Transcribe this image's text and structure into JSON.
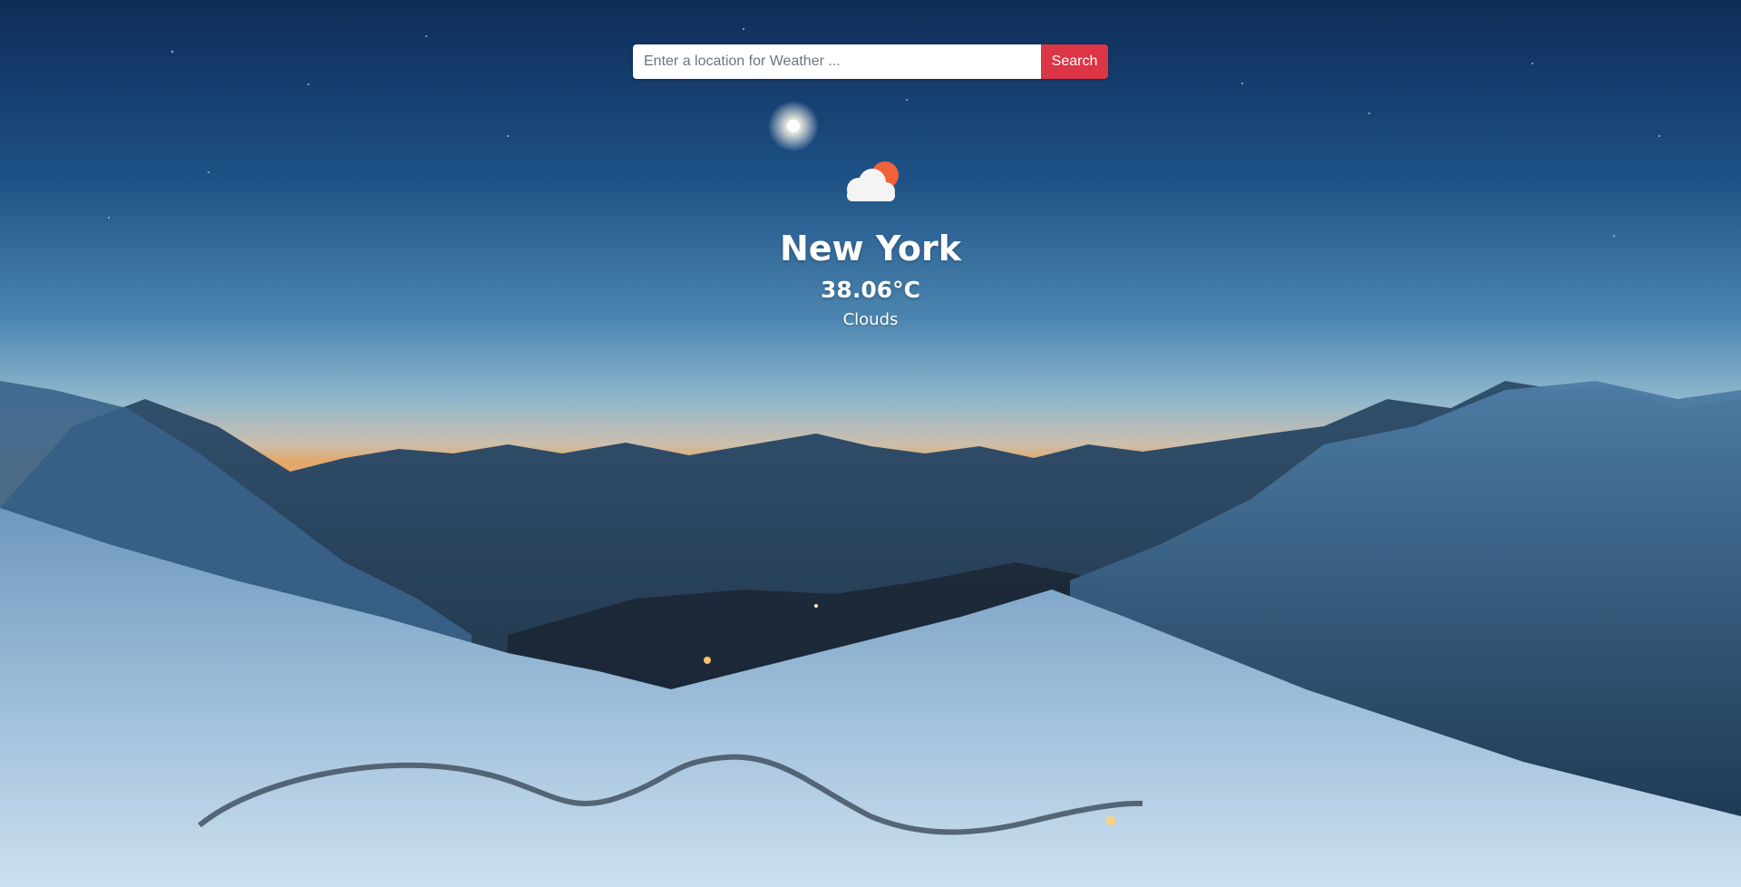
{
  "search": {
    "placeholder": "Enter a location for Weather ...",
    "value": "",
    "button_label": "Search"
  },
  "weather": {
    "icon": "cloud-sun-icon",
    "city": "New York",
    "temperature": "38.06°C",
    "condition": "Clouds"
  },
  "colors": {
    "search_button": "#dc3545",
    "sun": "#f0623a",
    "cloud": "#f4f4f4",
    "text": "#ffffff"
  }
}
